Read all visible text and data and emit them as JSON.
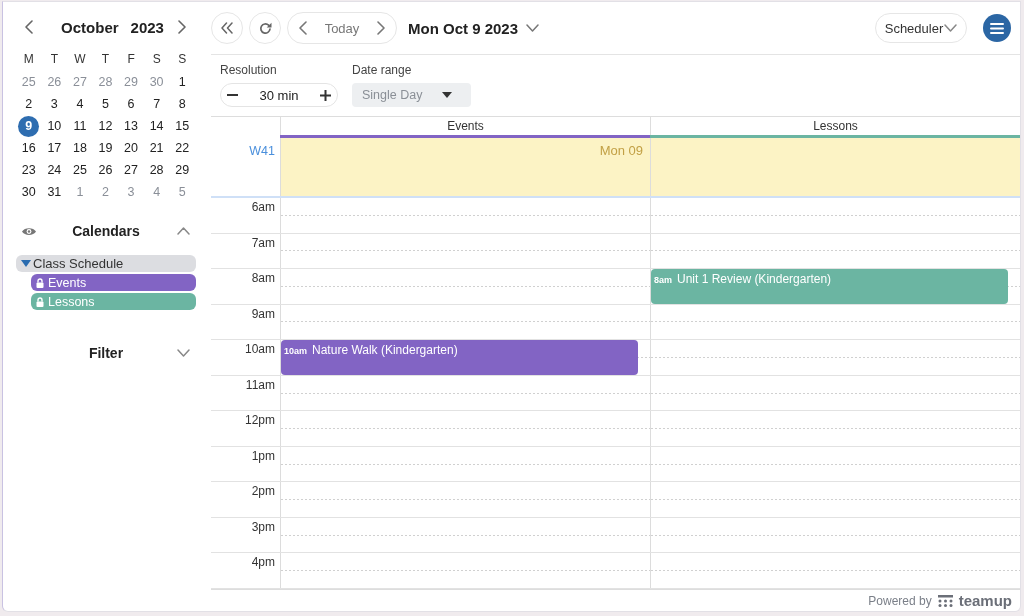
{
  "mini_calendar": {
    "month": "October",
    "year": "2023",
    "weekdays": [
      "M",
      "T",
      "W",
      "T",
      "F",
      "S",
      "S"
    ],
    "weeks": [
      [
        {
          "day": "25",
          "outside_month": true,
          "selected": false
        },
        {
          "day": "26",
          "outside_month": true,
          "selected": false
        },
        {
          "day": "27",
          "outside_month": true,
          "selected": false
        },
        {
          "day": "28",
          "outside_month": true,
          "selected": false
        },
        {
          "day": "29",
          "outside_month": true,
          "selected": false
        },
        {
          "day": "30",
          "outside_month": true,
          "selected": false
        },
        {
          "day": "1",
          "outside_month": false,
          "selected": false
        }
      ],
      [
        {
          "day": "2",
          "outside_month": false,
          "selected": false
        },
        {
          "day": "3",
          "outside_month": false,
          "selected": false
        },
        {
          "day": "4",
          "outside_month": false,
          "selected": false
        },
        {
          "day": "5",
          "outside_month": false,
          "selected": false
        },
        {
          "day": "6",
          "outside_month": false,
          "selected": false
        },
        {
          "day": "7",
          "outside_month": false,
          "selected": false
        },
        {
          "day": "8",
          "outside_month": false,
          "selected": false
        }
      ],
      [
        {
          "day": "9",
          "outside_month": false,
          "selected": true
        },
        {
          "day": "10",
          "outside_month": false,
          "selected": false
        },
        {
          "day": "11",
          "outside_month": false,
          "selected": false
        },
        {
          "day": "12",
          "outside_month": false,
          "selected": false
        },
        {
          "day": "13",
          "outside_month": false,
          "selected": false
        },
        {
          "day": "14",
          "outside_month": false,
          "selected": false
        },
        {
          "day": "15",
          "outside_month": false,
          "selected": false
        }
      ],
      [
        {
          "day": "16",
          "outside_month": false,
          "selected": false
        },
        {
          "day": "17",
          "outside_month": false,
          "selected": false
        },
        {
          "day": "18",
          "outside_month": false,
          "selected": false
        },
        {
          "day": "19",
          "outside_month": false,
          "selected": false
        },
        {
          "day": "20",
          "outside_month": false,
          "selected": false
        },
        {
          "day": "21",
          "outside_month": false,
          "selected": false
        },
        {
          "day": "22",
          "outside_month": false,
          "selected": false
        }
      ],
      [
        {
          "day": "23",
          "outside_month": false,
          "selected": false
        },
        {
          "day": "24",
          "outside_month": false,
          "selected": false
        },
        {
          "day": "25",
          "outside_month": false,
          "selected": false
        },
        {
          "day": "26",
          "outside_month": false,
          "selected": false
        },
        {
          "day": "27",
          "outside_month": false,
          "selected": false
        },
        {
          "day": "28",
          "outside_month": false,
          "selected": false
        },
        {
          "day": "29",
          "outside_month": false,
          "selected": false
        }
      ],
      [
        {
          "day": "30",
          "outside_month": false,
          "selected": false
        },
        {
          "day": "31",
          "outside_month": false,
          "selected": false
        },
        {
          "day": "1",
          "outside_month": true,
          "selected": false
        },
        {
          "day": "2",
          "outside_month": true,
          "selected": false
        },
        {
          "day": "3",
          "outside_month": true,
          "selected": false
        },
        {
          "day": "4",
          "outside_month": true,
          "selected": false
        },
        {
          "day": "5",
          "outside_month": true,
          "selected": false
        }
      ]
    ]
  },
  "calendars_panel": {
    "title": "Calendars",
    "expanded": true,
    "groups": [
      {
        "name": "Class Schedule",
        "expanded": true,
        "children": [
          {
            "name": "Events",
            "color": "#8264c4",
            "locked": true
          },
          {
            "name": "Lessons",
            "color": "#6bb5a2",
            "locked": true
          }
        ]
      }
    ]
  },
  "filter_panel": {
    "title": "Filter",
    "expanded": false
  },
  "toolbar": {
    "today": "Today",
    "date_title": "Mon Oct 9 2023",
    "view": "Scheduler"
  },
  "options": {
    "resolution": {
      "label": "Resolution",
      "value": "30 min"
    },
    "date_range": {
      "label": "Date range",
      "value": "Single Day",
      "disabled": true
    }
  },
  "scheduler": {
    "columns": [
      {
        "name": "Events",
        "color": "#8264c4"
      },
      {
        "name": "Lessons",
        "color": "#6bb5a2"
      }
    ],
    "week_label": "W41",
    "day_label": "Mon 09",
    "rows": [
      {
        "time": "6am"
      },
      {
        "time": "7am"
      },
      {
        "time": "8am",
        "cells": [
          {
            "kind": "free"
          },
          {
            "kind": "event",
            "time": "8am",
            "title": "Unit 1 Review (Kindergarten)"
          }
        ]
      },
      {
        "time": "9am"
      },
      {
        "time": "10am",
        "cells": [
          {
            "kind": "event",
            "time": "10am",
            "title": "Nature Walk (Kindergarten)"
          },
          {
            "kind": "free"
          }
        ]
      },
      {
        "time": "11am"
      },
      {
        "time": "12pm"
      },
      {
        "time": "1pm"
      },
      {
        "time": "2pm"
      },
      {
        "time": "3pm"
      },
      {
        "time": "4pm"
      }
    ]
  },
  "footer": {
    "powered_by": "Powered by",
    "brand": "teamup"
  }
}
